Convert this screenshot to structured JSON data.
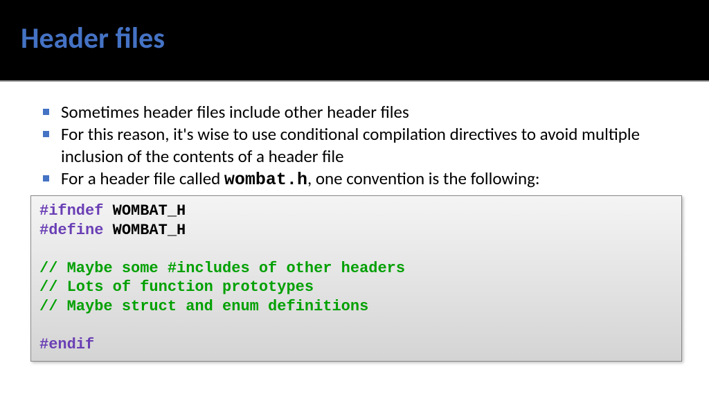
{
  "title": "Header files",
  "bullets": [
    "Sometimes header files include other header files",
    "For this reason, it's wise to use conditional compilation directives to avoid multiple inclusion of the contents of a header file",
    {
      "pre": "For a header file called ",
      "code": "wombat.h",
      "post": ", one convention is the following:"
    }
  ],
  "code": {
    "l1_pp": "#ifndef",
    "l1_id": " WOMBAT_H",
    "l2_pp": "#define",
    "l2_id": " WOMBAT_H",
    "blank1": "",
    "c1": "// Maybe some #includes of other headers",
    "c2": "// Lots of function prototypes",
    "c3": "// Maybe struct and enum definitions",
    "blank2": "",
    "l3_pp": "#endif"
  }
}
